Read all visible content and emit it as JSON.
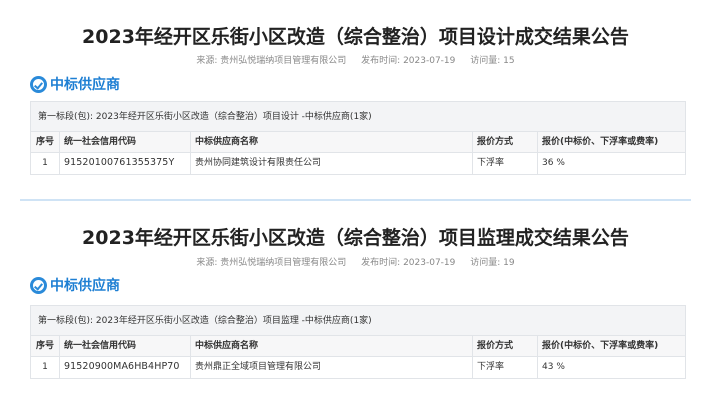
{
  "notices": [
    {
      "title": "2023年经开区乐街小区改造（综合整治）项目设计成交结果公告",
      "source": "来源: 贵州弘悦瑞纳项目管理有限公司",
      "published": "发布时间: 2023-07-19",
      "views": "访问量: 15",
      "section_title": "中标供应商",
      "lot_caption": "第一标段(包): 2023年经开区乐街小区改造（综合整治）项目设计 -中标供应商(1家)",
      "columns": [
        "序号",
        "统一社会信用代码",
        "中标供应商名称",
        "报价方式",
        "报价(中标价、下浮率或费率)"
      ],
      "rows": [
        {
          "no": "1",
          "credit_code": "91520100761355375Y",
          "name": "贵州协同建筑设计有限责任公司",
          "quote_method": "下浮率",
          "quote": "36 %"
        }
      ]
    },
    {
      "title": "2023年经开区乐街小区改造（综合整治）项目监理成交结果公告",
      "source": "来源: 贵州弘悦瑞纳项目管理有限公司",
      "published": "发布时间: 2023-07-19",
      "views": "访问量: 19",
      "section_title": "中标供应商",
      "lot_caption": "第一标段(包): 2023年经开区乐街小区改造（综合整治）项目监理 -中标供应商(1家)",
      "columns": [
        "序号",
        "统一社会信用代码",
        "中标供应商名称",
        "报价方式",
        "报价(中标价、下浮率或费率)"
      ],
      "rows": [
        {
          "no": "1",
          "credit_code": "91520900MA6HB4HP70",
          "name": "贵州鼎正全域项目管理有限公司",
          "quote_method": "下浮率",
          "quote": "43 %"
        }
      ]
    }
  ],
  "colors": {
    "accent": "#1e7fd3",
    "border": "#e1e4e8",
    "caption_bg": "#f3f4f6"
  },
  "icons": {
    "section": "check-circle-icon"
  }
}
